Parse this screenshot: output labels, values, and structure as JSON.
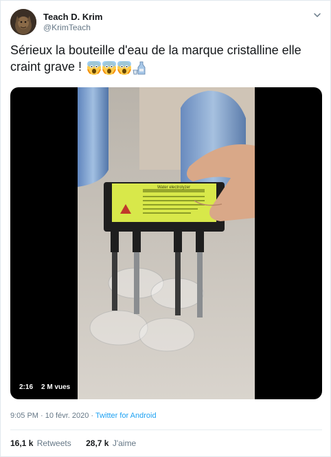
{
  "author": {
    "name": "Teach D. Krim",
    "handle": "@KrimTeach"
  },
  "tweet": {
    "text": "Sérieux la bouteille d'eau de la marque cristalline elle craint grave !",
    "emojis": [
      "screaming-face",
      "screaming-face",
      "screaming-face",
      "sake-bottle-and-cup"
    ]
  },
  "media": {
    "duration": "2:16",
    "views": "2 M vues",
    "device_label": "Water electrolyzer"
  },
  "meta": {
    "time": "9:05 PM",
    "separator": " · ",
    "date": "10 févr. 2020",
    "source": "Twitter for Android"
  },
  "stats": {
    "retweets_count": "16,1 k",
    "retweets_label": "Retweets",
    "likes_count": "28,7 k",
    "likes_label": "J'aime"
  },
  "colors": {
    "link": "#1da1f2",
    "secondary_text": "#657786",
    "divider": "#e6ecf0",
    "device_yellow": "#d8e84a"
  }
}
